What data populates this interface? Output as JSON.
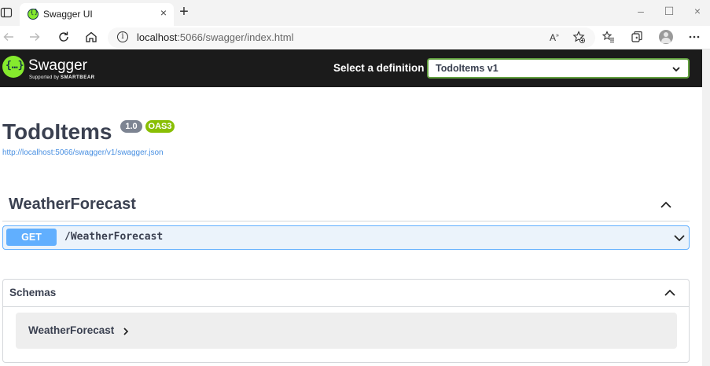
{
  "browser": {
    "tab_title": "Swagger UI",
    "address_host": "localhost",
    "address_path": ":5066/swagger/index.html"
  },
  "swagger": {
    "logo_text": "Swagger",
    "logo_sub_prefix": "Supported by ",
    "logo_sub_brand": "SMARTBEAR",
    "select_label": "Select a definition",
    "select_value": "TodoItems v1"
  },
  "info": {
    "title": "TodoItems",
    "version": "1.0",
    "oas": "OAS3",
    "spec_url": "http://localhost:5066/swagger/v1/swagger.json"
  },
  "tag": {
    "name": "WeatherForecast",
    "operations": [
      {
        "method": "GET",
        "path": "/WeatherForecast"
      }
    ]
  },
  "schemas": {
    "title": "Schemas",
    "models": [
      "WeatherForecast"
    ]
  },
  "colors": {
    "swagger_green": "#85ea2d",
    "topbar": "#1b1b1b",
    "get_blue": "#61affe",
    "text": "#3b4151"
  }
}
